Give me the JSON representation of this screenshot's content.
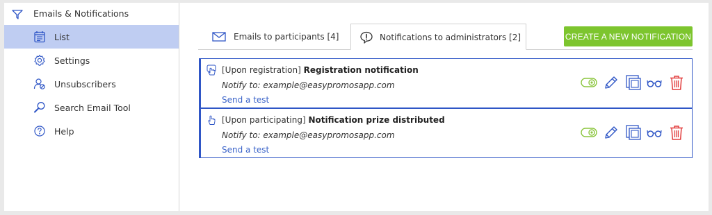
{
  "sidebar": {
    "header": {
      "label": "Emails & Notifications",
      "icon": "paper-plane-icon"
    },
    "items": [
      {
        "label": "List",
        "icon": "list-icon",
        "active": true
      },
      {
        "label": "Settings",
        "icon": "gear-icon",
        "active": false
      },
      {
        "label": "Unsubscribers",
        "icon": "user-blocked-icon",
        "active": false
      },
      {
        "label": "Search Email Tool",
        "icon": "search-icon",
        "active": false
      },
      {
        "label": "Help",
        "icon": "help-icon",
        "active": false
      }
    ]
  },
  "main": {
    "tabs": [
      {
        "label": "Emails to participants [4]",
        "icon": "envelope-icon",
        "active": false
      },
      {
        "label": "Notifications to administrators [2]",
        "icon": "alert-bubble-icon",
        "active": true
      }
    ],
    "create_button": "CREATE A NEW NOTIFICATION",
    "notifications": [
      {
        "prefix": "[Upon registration]",
        "name": "Registration notification",
        "notify": "Notify to: example@easypromosapp.com",
        "send_test": "Send a test"
      },
      {
        "prefix": "[Upon participating]",
        "name": "Notification prize distributed",
        "notify": "Notify to: example@easypromosapp.com",
        "send_test": "Send a test"
      }
    ]
  },
  "colors": {
    "accent_blue": "#2f56c6",
    "active_bg": "#bfcdf2",
    "create_green": "#7dc52e",
    "toggle_green": "#8cc63f",
    "delete_red": "#e23b3b",
    "link_blue": "#3a63c9"
  }
}
